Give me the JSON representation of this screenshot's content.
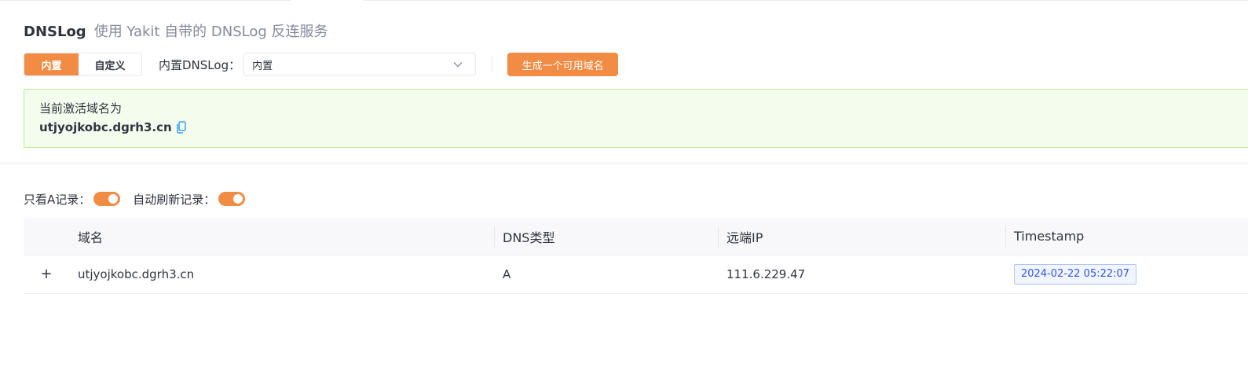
{
  "header": {
    "title": "DNSLog",
    "subtitle": "使用 Yakit 自带的 DNSLog 反连服务"
  },
  "mode_tabs": [
    {
      "label": "内置",
      "active": true
    },
    {
      "label": "自定义",
      "active": false
    }
  ],
  "dns_select": {
    "label": "内置DNSLog：",
    "value": "内置"
  },
  "generate_button": {
    "label": "生成一个可用域名"
  },
  "alert": {
    "title": "当前激活域名为",
    "domain": "utjyojkobc.dgrh3.cn"
  },
  "toggles": {
    "only_a_label": "只看A记录：",
    "only_a_on": true,
    "auto_refresh_label": "自动刷新记录：",
    "auto_refresh_on": true
  },
  "table": {
    "columns": [
      "域名",
      "DNS类型",
      "远端IP",
      "Timestamp"
    ],
    "rows": [
      {
        "expand": "+",
        "domain": "utjyojkobc.dgrh3.cn",
        "type": "A",
        "ip": "111.6.229.47",
        "timestamp": "2024-02-22 05:22:07"
      }
    ]
  },
  "colors": {
    "accent": "#f28b44",
    "alert_bg": "#f4fcee",
    "alert_border": "#b7eb8f",
    "tag_border": "#adc6ff",
    "tag_text": "#2f54eb"
  },
  "icons": {
    "select_arrow": "chevron-down-icon",
    "copy": "copy-icon"
  }
}
